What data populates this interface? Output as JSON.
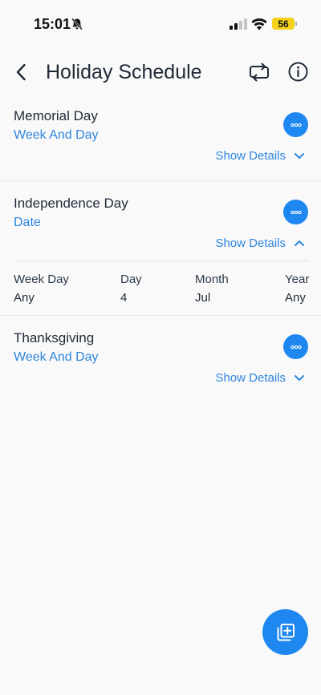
{
  "status_bar": {
    "time": "15:01",
    "battery": "56"
  },
  "header": {
    "title": "Holiday Schedule"
  },
  "holidays": [
    {
      "name": "Memorial Day",
      "type": "Week And Day",
      "toggle": "Show Details",
      "expanded": false
    },
    {
      "name": "Independence Day",
      "type": "Date",
      "toggle": "Show Details",
      "expanded": true,
      "details": {
        "labels": [
          "Week Day",
          "Day",
          "Month",
          "Year"
        ],
        "values": [
          "Any",
          "4",
          "Jul",
          "Any"
        ]
      }
    },
    {
      "name": "Thanksgiving",
      "type": "Week And Day",
      "toggle": "Show Details",
      "expanded": false
    }
  ],
  "colors": {
    "accent": "#1e88f0",
    "link": "#2e86de",
    "text": "#1f2a37",
    "background": "#f9f9fa",
    "battery": "#f5d11e"
  },
  "icons": {
    "back": "chevron-left-icon",
    "sync": "repeat-icon",
    "info": "info-icon",
    "more": "more-horizontal-icon",
    "expand": "chevron-down-icon",
    "collapse": "chevron-up-icon",
    "add": "add-to-stack-icon"
  }
}
